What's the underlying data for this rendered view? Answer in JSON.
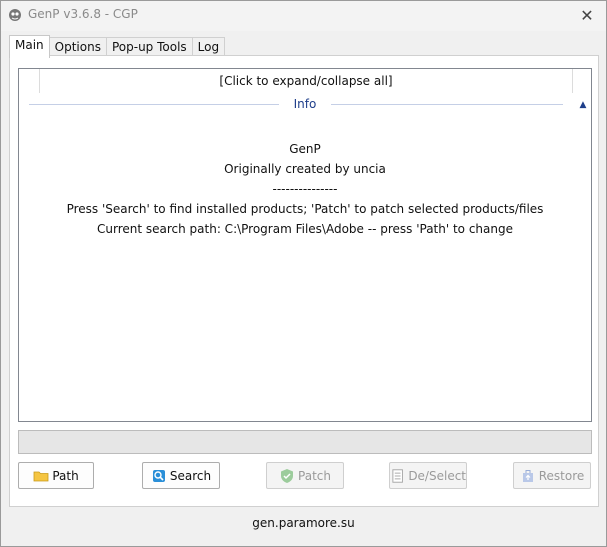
{
  "window": {
    "title": "GenP v3.6.8 - CGP",
    "close_glyph": "✕"
  },
  "tabs": [
    {
      "label": "Main",
      "active": true
    },
    {
      "label": "Options",
      "active": false
    },
    {
      "label": "Pop-up Tools",
      "active": false
    },
    {
      "label": "Log",
      "active": false
    }
  ],
  "list": {
    "expand_all": "[Click to expand/collapse all]",
    "group_title": "Info",
    "collapse_glyph": "▲",
    "lines": [
      "GenP",
      "Originally created by uncia",
      "---------------",
      "Press 'Search' to find installed products; 'Patch' to patch selected products/files",
      "Current search path: C:\\Program Files\\Adobe -- press 'Path' to change"
    ]
  },
  "buttons": {
    "path": {
      "label": "Path",
      "icon": "folder-icon",
      "enabled": true
    },
    "search": {
      "label": "Search",
      "icon": "search-icon",
      "enabled": true
    },
    "patch": {
      "label": "Patch",
      "icon": "shield-icon",
      "enabled": false
    },
    "deselect": {
      "label": "De/Select",
      "icon": "checklist-icon",
      "enabled": false
    },
    "restore": {
      "label": "Restore",
      "icon": "restore-icon",
      "enabled": false
    }
  },
  "footer": {
    "link": "gen.paramore.su"
  },
  "colors": {
    "group_title": "#1e3e8a",
    "disabled_text": "#9a9a9a"
  }
}
